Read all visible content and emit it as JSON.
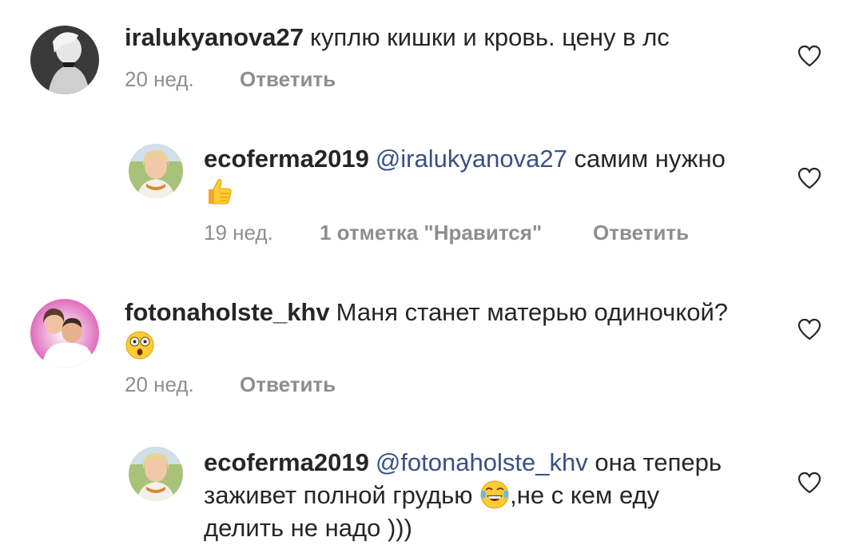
{
  "comments": [
    {
      "username": "iralukyanova27",
      "text": "куплю кишки и кровь. цену в лс",
      "time": "20 нед.",
      "reply_label": "Ответить",
      "avatar": "grayscale-portrait"
    },
    {
      "username": "ecoferma2019",
      "mention": "@iralukyanova27",
      "text": "самим нужно",
      "emoji": "thumbs-up",
      "time": "19 нед.",
      "likes": "1 отметка \"Нравится\"",
      "reply_label": "Ответить",
      "avatar": "blonde-woman-portrait"
    },
    {
      "username": "fotonaholste_khv",
      "text": "Маня станет матерью одиночкой?",
      "emoji": "astonished-face",
      "time": "20 нед.",
      "reply_label": "Ответить",
      "avatar": "couple-photo"
    },
    {
      "username": "ecoferma2019",
      "mention": "@fotonaholste_khv",
      "text_line1": "она теперь",
      "text_line2a": "заживет полной грудью",
      "emoji": "face-with-tears-of-joy",
      "text_line2b": ",не с кем еду",
      "text_line3": "делить не надо )))",
      "avatar": "blonde-woman-portrait"
    }
  ],
  "colors": {
    "text": "#262626",
    "meta": "#8e8e8e",
    "mention": "#385185"
  },
  "icons": [
    "heart-outline-icon"
  ]
}
